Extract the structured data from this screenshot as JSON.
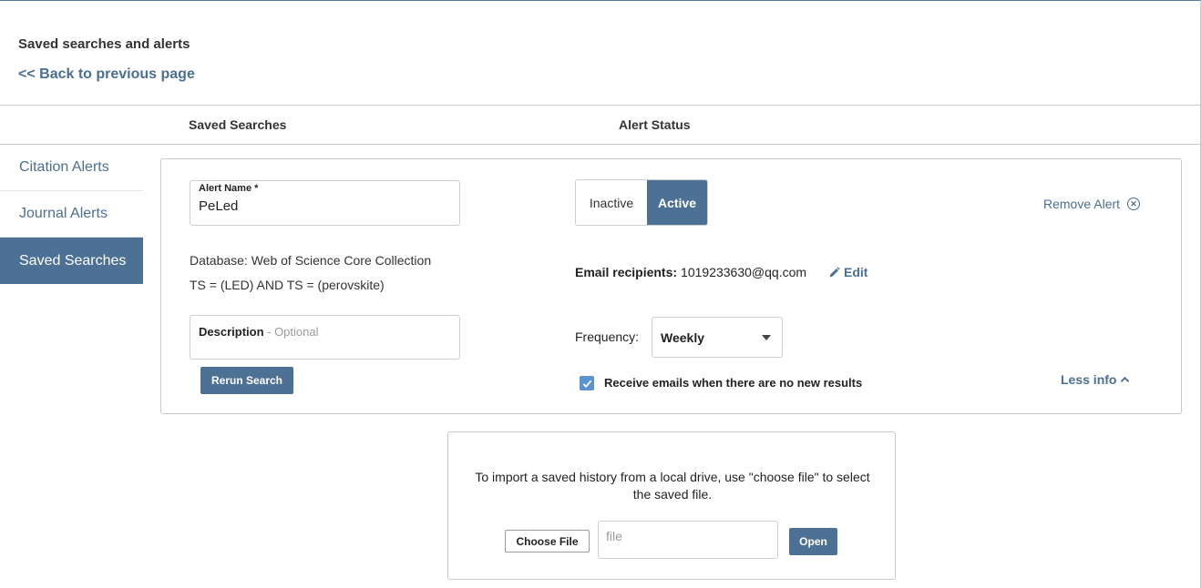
{
  "header": {
    "title": "Saved searches and alerts",
    "back_link": "<< Back to previous page"
  },
  "columns": {
    "saved_searches": "Saved Searches",
    "alert_status": "Alert Status"
  },
  "sidebar": {
    "items": [
      {
        "label": "Citation Alerts",
        "active": false
      },
      {
        "label": "Journal Alerts",
        "active": false
      },
      {
        "label": "Saved Searches",
        "active": true
      }
    ]
  },
  "alert": {
    "name_label": "Alert Name *",
    "name_value": "PeLed",
    "database": "Database: Web of Science Core Collection",
    "query": "TS = (LED) AND TS = (perovskite)",
    "description_label": "Description",
    "description_optional": " - Optional",
    "rerun_label": "Rerun Search",
    "status_inactive": "Inactive",
    "status_active": "Active",
    "remove_label": "Remove Alert",
    "email_label": "Email recipients:",
    "email_value": "1019233630@qq.com",
    "edit_label": "Edit",
    "frequency_label": "Frequency:",
    "frequency_value": "Weekly",
    "no_results_label": "Receive emails when there are no new results",
    "no_results_checked": true,
    "less_info_label": "Less info"
  },
  "import": {
    "text": "To import a saved history from a local drive, use \"choose file\" to select the saved file.",
    "choose_label": "Choose File",
    "file_placeholder": "file",
    "open_label": "Open"
  },
  "colors": {
    "accent": "#4d7095",
    "link": "#4a6f93",
    "checkbox": "#5b93cf"
  },
  "icons": {
    "remove": "circle-x-icon",
    "edit": "pencil-icon",
    "less_info": "chevron-up-icon",
    "frequency": "caret-down-icon",
    "checkbox": "check-icon"
  }
}
